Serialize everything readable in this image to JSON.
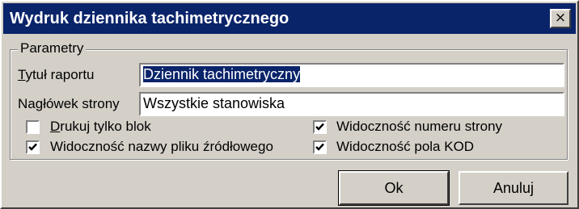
{
  "window": {
    "title": "Wydruk dziennika tachimetrycznego",
    "close_glyph": "×"
  },
  "group": {
    "legend": "Parametry"
  },
  "fields": {
    "report_title": {
      "label_first": "T",
      "label_rest": "ytuł raportu",
      "value": "Dziennik tachimetryczny"
    },
    "page_header": {
      "label_before": "Na",
      "label_accel": "g",
      "label_after": "łówek strony",
      "value": "Wszystkie stanowiska"
    }
  },
  "checkboxes": {
    "print_block_only": {
      "label_accel": "D",
      "label_rest": "rukuj tylko blok",
      "checked": false
    },
    "show_source_filename": {
      "label": "Widoczność nazwy pliku źródłowego",
      "checked": true
    },
    "show_page_number": {
      "label": "Widoczność numeru strony",
      "checked": true
    },
    "show_kod_field": {
      "label": "Widoczność pola KOD",
      "checked": true
    }
  },
  "buttons": {
    "ok_label": "Ok",
    "cancel_label": "Anuluj"
  },
  "colors": {
    "face": "#d4d0c8",
    "titlebar": "#0a246a",
    "selection": "#0a246a"
  },
  "icons": {
    "close": "close-icon",
    "check": "checkmark-icon"
  }
}
